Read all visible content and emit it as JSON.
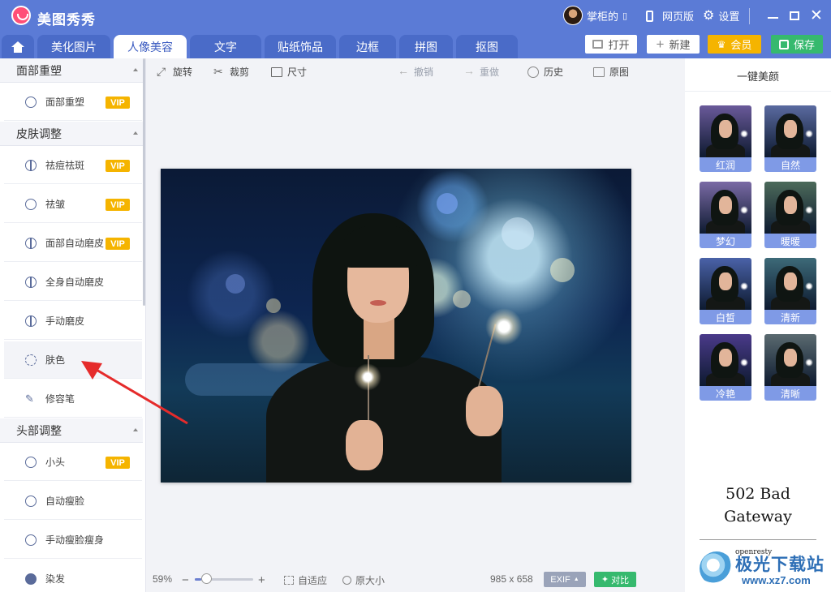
{
  "app": {
    "title": "美图秀秀",
    "user_name": "掌柜的",
    "web_version": "网页版",
    "settings": "设置"
  },
  "tabs": [
    {
      "label": "美化图片"
    },
    {
      "label": "人像美容",
      "active": true
    },
    {
      "label": "文字"
    },
    {
      "label": "贴纸饰品"
    },
    {
      "label": "边框"
    },
    {
      "label": "拼图"
    },
    {
      "label": "抠图"
    }
  ],
  "actions": {
    "open": "打开",
    "new": "新建",
    "vip": "会员",
    "save": "保存"
  },
  "sidebar": {
    "sections": [
      {
        "title": "面部重塑",
        "items": [
          {
            "label": "面部重塑",
            "vip": true,
            "icon": "face-icon"
          }
        ]
      },
      {
        "title": "皮肤调整",
        "items": [
          {
            "label": "祛痘祛斑",
            "vip": true,
            "icon": "half-circle-icon"
          },
          {
            "label": "祛皱",
            "vip": true,
            "icon": "smile-icon"
          },
          {
            "label": "面部自动磨皮",
            "vip": true,
            "icon": "half-circle-icon"
          },
          {
            "label": "全身自动磨皮",
            "vip": false,
            "icon": "half-circle-icon"
          },
          {
            "label": "手动磨皮",
            "vip": false,
            "icon": "half-circle-icon"
          },
          {
            "label": "肤色",
            "vip": false,
            "icon": "dashed-circle-icon",
            "selected": true
          },
          {
            "label": "修容笔",
            "vip": false,
            "icon": "brush-icon"
          }
        ]
      },
      {
        "title": "头部调整",
        "items": [
          {
            "label": "小头",
            "vip": true,
            "icon": "head-icon"
          },
          {
            "label": "自动瘦脸",
            "vip": false,
            "icon": "slim-face-icon"
          },
          {
            "label": "手动瘦脸瘦身",
            "vip": false,
            "icon": "slim-face-icon"
          },
          {
            "label": "染发",
            "vip": false,
            "icon": "hair-dye-icon"
          }
        ]
      }
    ],
    "vip_label": "VIP"
  },
  "toolbar": {
    "rotate": "旋转",
    "crop": "裁剪",
    "size": "尺寸",
    "undo": "撤销",
    "redo": "重做",
    "history": "历史",
    "original": "原图"
  },
  "status": {
    "zoom": "59%",
    "zoom_fraction": 0.59,
    "fit": "自适应",
    "actual_size": "原大小",
    "dimensions": "985 x 658",
    "exif": "EXIF",
    "compare": "对比"
  },
  "right_panel": {
    "title": "一键美颜",
    "presets": [
      {
        "label": "红润"
      },
      {
        "label": "自然"
      },
      {
        "label": "梦幻"
      },
      {
        "label": "暖暖"
      },
      {
        "label": "白皙"
      },
      {
        "label": "清新"
      },
      {
        "label": "冷艳"
      },
      {
        "label": "清晰"
      }
    ],
    "error_text": "502 Bad Gateway",
    "error_server": "openresty"
  },
  "watermark": {
    "name": "极光下载站",
    "url": "www.xz7.com"
  },
  "colors": {
    "brand": "#5b7bd6",
    "vip": "#f5b400",
    "save": "#36b96e",
    "arrow": "#e52b2b"
  }
}
